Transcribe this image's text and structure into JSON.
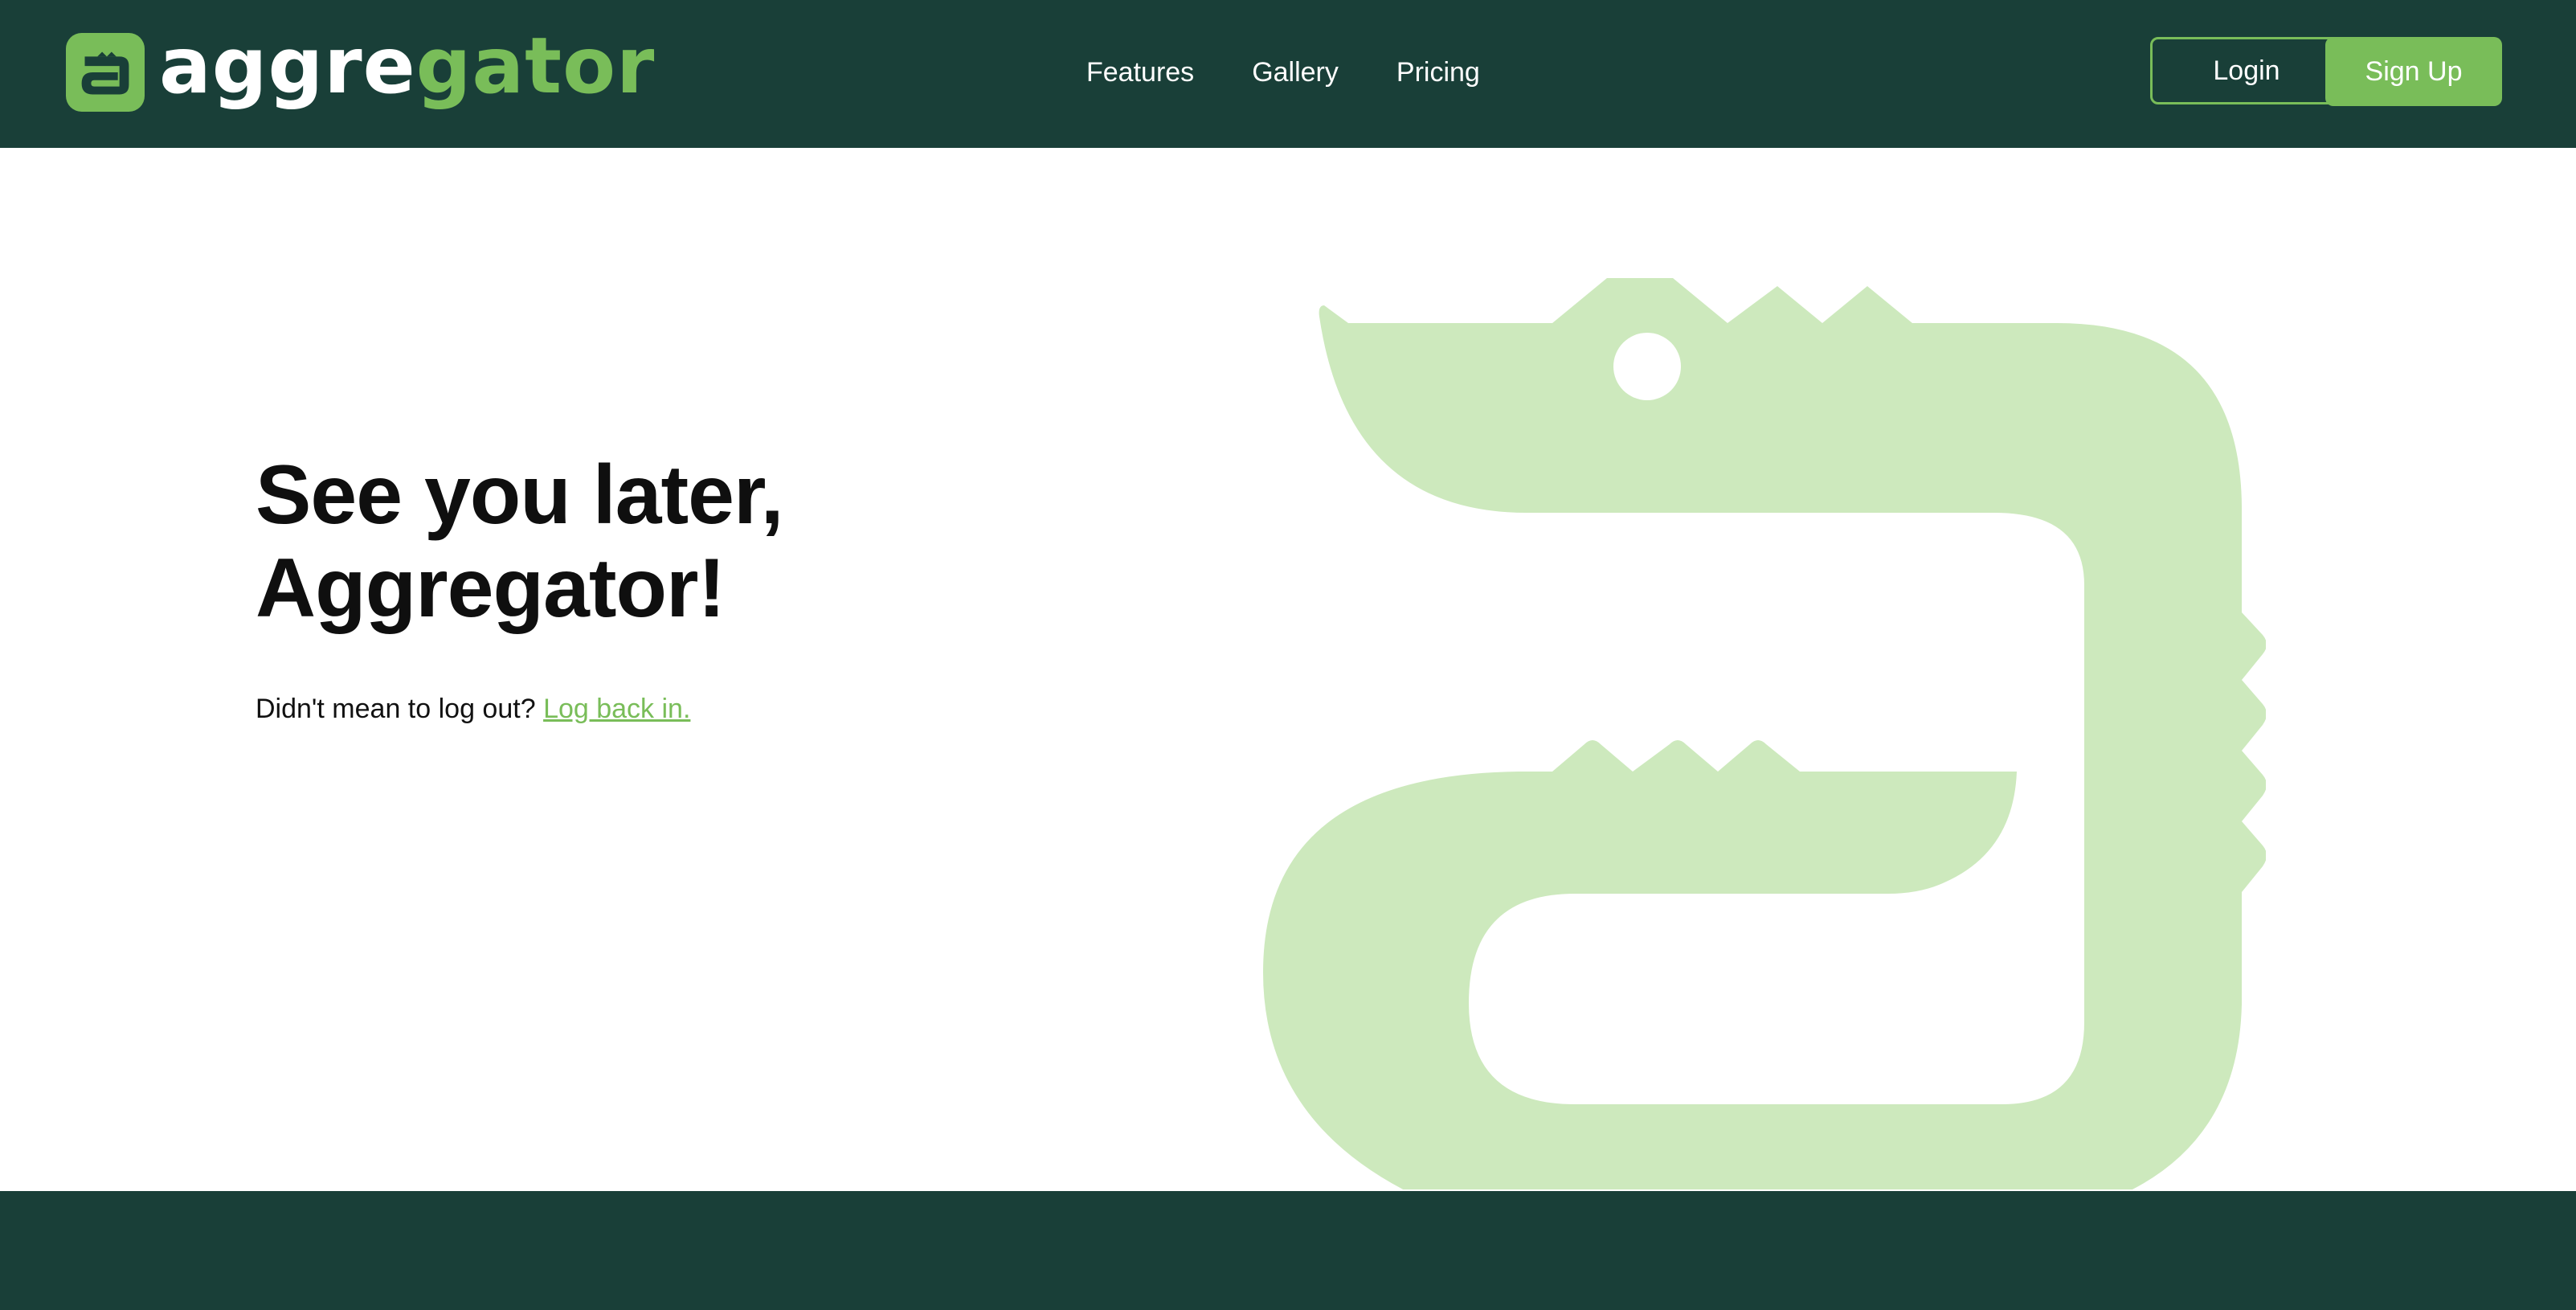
{
  "header": {
    "logo": {
      "wordmark_light": "aggre",
      "wordmark_accent": "gator",
      "icon": "gator-a-icon"
    },
    "nav": [
      {
        "label": "Features"
      },
      {
        "label": "Gallery"
      },
      {
        "label": "Pricing"
      }
    ],
    "login_label": "Login",
    "signup_label": "Sign Up"
  },
  "main": {
    "headline_line1": "See you later,",
    "headline_line2": "Aggregator!",
    "prompt_text": "Didn't mean to log out?",
    "relogin_link": "Log back in.",
    "illustration": "alligator-a-illustration"
  },
  "colors": {
    "header_bg": "#193f38",
    "accent": "#79bd59",
    "mascot": "#cde9bd",
    "text": "#0f0f0f"
  }
}
